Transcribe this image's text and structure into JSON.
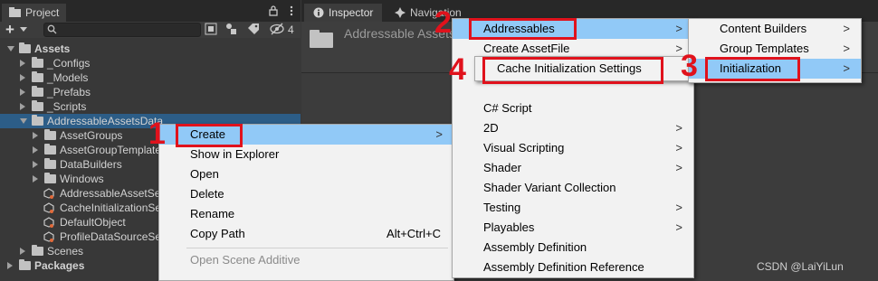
{
  "project": {
    "tab_label": "Project",
    "add_label": "+",
    "hidden_count": "4",
    "tree": [
      {
        "label": "Assets",
        "indent": 0,
        "kind": "folder",
        "expanded": true,
        "bold": true
      },
      {
        "label": "_Configs",
        "indent": 1,
        "kind": "folder",
        "expanded": false
      },
      {
        "label": "_Models",
        "indent": 1,
        "kind": "folder",
        "expanded": false
      },
      {
        "label": "_Prefabs",
        "indent": 1,
        "kind": "folder",
        "expanded": false
      },
      {
        "label": "_Scripts",
        "indent": 1,
        "kind": "folder",
        "expanded": false
      },
      {
        "label": "AddressableAssetsData",
        "indent": 1,
        "kind": "folder",
        "expanded": true,
        "selected": true
      },
      {
        "label": "AssetGroups",
        "indent": 2,
        "kind": "folder",
        "expanded": false
      },
      {
        "label": "AssetGroupTemplates",
        "indent": 2,
        "kind": "folder",
        "expanded": false
      },
      {
        "label": "DataBuilders",
        "indent": 2,
        "kind": "folder",
        "expanded": false
      },
      {
        "label": "Windows",
        "indent": 2,
        "kind": "folder",
        "expanded": false
      },
      {
        "label": "AddressableAssetSettings",
        "indent": 2,
        "kind": "asset"
      },
      {
        "label": "CacheInitializationSettings",
        "indent": 2,
        "kind": "asset"
      },
      {
        "label": "DefaultObject",
        "indent": 2,
        "kind": "asset"
      },
      {
        "label": "ProfileDataSourceSettings",
        "indent": 2,
        "kind": "asset"
      },
      {
        "label": "Scenes",
        "indent": 1,
        "kind": "folder",
        "expanded": false
      },
      {
        "label": "Packages",
        "indent": 0,
        "kind": "folder",
        "expanded": false,
        "bold": true
      }
    ]
  },
  "inspector": {
    "tab_label": "Inspector",
    "nav_tab_label": "Navigation",
    "title": "Addressable Assets Data"
  },
  "context_menu": {
    "items": [
      {
        "label": "Create",
        "submenu": true,
        "highlighted": true
      },
      {
        "label": "Show in Explorer"
      },
      {
        "label": "Open"
      },
      {
        "label": "Delete"
      },
      {
        "label": "Rename"
      },
      {
        "label": "Copy Path",
        "shortcut": "Alt+Ctrl+C"
      },
      {
        "label": "Open Scene Additive",
        "disabled": true
      }
    ]
  },
  "create_menu": {
    "items": [
      {
        "label": "Addressables",
        "submenu": true,
        "highlighted": true
      },
      {
        "label": "Create AssetFile",
        "submenu": true
      },
      {
        "label": "C# Script"
      },
      {
        "label": "2D",
        "submenu": true
      },
      {
        "label": "Visual Scripting",
        "submenu": true
      },
      {
        "label": "Shader",
        "submenu": true
      },
      {
        "label": "Shader Variant Collection"
      },
      {
        "label": "Testing",
        "submenu": true
      },
      {
        "label": "Playables",
        "submenu": true
      },
      {
        "label": "Assembly Definition"
      },
      {
        "label": "Assembly Definition Reference"
      }
    ]
  },
  "create_assetfile_menu": {
    "items": [
      {
        "label": "Cache Initialization Settings"
      }
    ]
  },
  "addressables_menu": {
    "items": [
      {
        "label": "Content Builders",
        "submenu": true
      },
      {
        "label": "Group Templates",
        "submenu": true
      },
      {
        "label": "Initialization",
        "submenu": true,
        "highlighted": true
      }
    ]
  },
  "annotations": {
    "step1": "1",
    "step2": "2",
    "step3": "3",
    "step4": "4",
    "color": "#e0121c"
  },
  "submenu_arrow": ">",
  "watermark": "CSDN @LaiYiLun"
}
